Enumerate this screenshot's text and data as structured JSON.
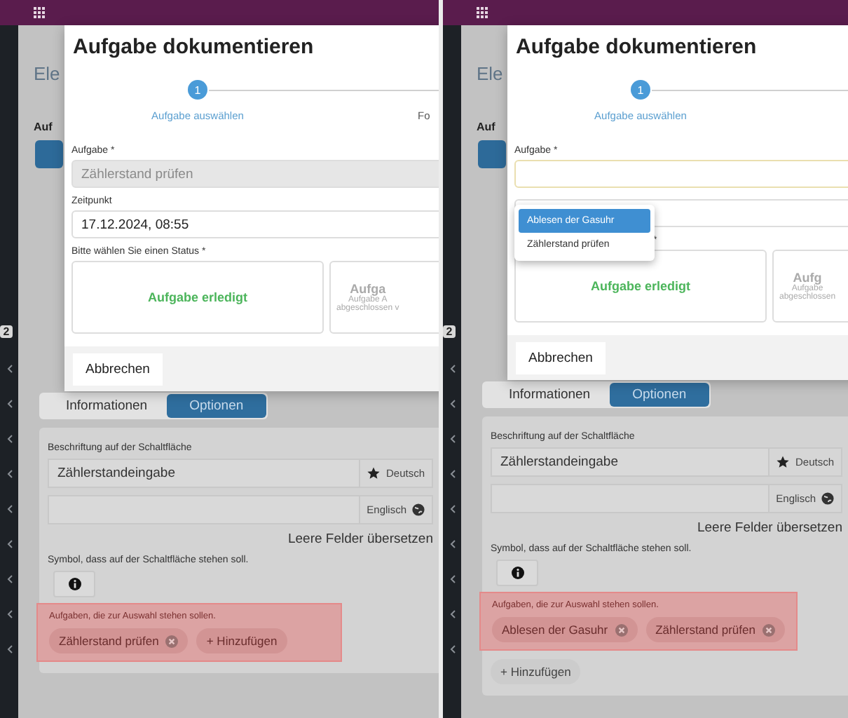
{
  "panels": [
    {
      "sidebar": {
        "badge": "2"
      },
      "page": {
        "title": "Ele",
        "section": "Auf"
      },
      "dialog": {
        "title": "Aufgabe dokumentieren",
        "step": {
          "number": "1",
          "label": "Aufgabe auswählen",
          "next_label": "Fo"
        },
        "fields": [
          {
            "label": "Aufgabe *",
            "value": "Zählerstand prüfen",
            "disabled": true,
            "focused": false
          },
          {
            "label": "Zeitpunkt",
            "value": "17.12.2024, 08:55",
            "disabled": false,
            "focused": false
          }
        ],
        "status_label": "Bitte wählen Sie einen Status *",
        "status_options": [
          {
            "kind": "done",
            "title": "Aufgabe erledigt"
          },
          {
            "kind": "other",
            "title": "Aufga",
            "lines": [
              "Aufgabe A",
              "abgeschlossen v"
            ]
          }
        ],
        "cancel": "Abbrechen"
      },
      "tabs": [
        {
          "label": "Informationen",
          "selected": false
        },
        {
          "label": "Optionen",
          "selected": true
        }
      ],
      "card": {
        "caption_label": "Beschriftung auf der Schaltfläche",
        "translations": [
          {
            "kind": "default",
            "value": "Zählerstandeingabe",
            "language": "Deutsch"
          },
          {
            "kind": "translation",
            "language": "Englisch"
          }
        ],
        "translate_button": "Leere Felder übersetzen",
        "symbol_label": "Symbol, dass auf der Schaltfläche stehen soll.",
        "tasks": {
          "highlighted": true,
          "label": "Aufgaben, die zur Auswahl stehen sollen.",
          "items": [
            {
              "label": "Zählerstand prüfen"
            }
          ],
          "add_button": {
            "label": "+ Hinzufügen",
            "highlighted": true
          }
        }
      }
    },
    {
      "sidebar": {
        "badge": "2"
      },
      "page": {
        "title": "Ele",
        "section": "Auf"
      },
      "dialog": {
        "title": "Aufgabe dokumentieren",
        "step": {
          "number": "1",
          "label": "Aufgabe auswählen"
        },
        "fields": [
          {
            "label": "Aufgabe *",
            "disabled": false,
            "focused": true
          },
          {
            "disabled": false,
            "focused": false
          }
        ],
        "dropdown": {
          "options": [
            {
              "label": "Ablesen der Gasuhr",
              "selected": true
            },
            {
              "label": "Zählerstand prüfen",
              "selected": false
            }
          ]
        },
        "status_label": "*",
        "status_options": [
          {
            "kind": "done",
            "title": "Aufgabe erledigt"
          },
          {
            "kind": "other",
            "title": "Aufg",
            "lines": [
              "Aufgabe",
              "abgeschlossen"
            ]
          }
        ],
        "cancel": "Abbrechen"
      },
      "tabs": [
        {
          "label": "Informationen",
          "selected": false
        },
        {
          "label": "Optionen",
          "selected": true
        }
      ],
      "card": {
        "caption_label": "Beschriftung auf der Schaltfläche",
        "translations": [
          {
            "kind": "default",
            "value": "Zählerstandeingabe",
            "language": "Deutsch"
          },
          {
            "kind": "translation",
            "language": "Englisch"
          }
        ],
        "translate_button": "Leere Felder übersetzen",
        "symbol_label": "Symbol, dass auf der Schaltfläche stehen soll.",
        "tasks": {
          "highlighted": true,
          "label": "Aufgaben, die zur Auswahl stehen sollen.",
          "items": [
            {
              "label": "Ablesen der Gasuhr"
            },
            {
              "label": "Zählerstand prüfen"
            }
          ],
          "add_button": {
            "label": "+ Hinzufügen",
            "highlighted": false
          }
        }
      }
    }
  ]
}
